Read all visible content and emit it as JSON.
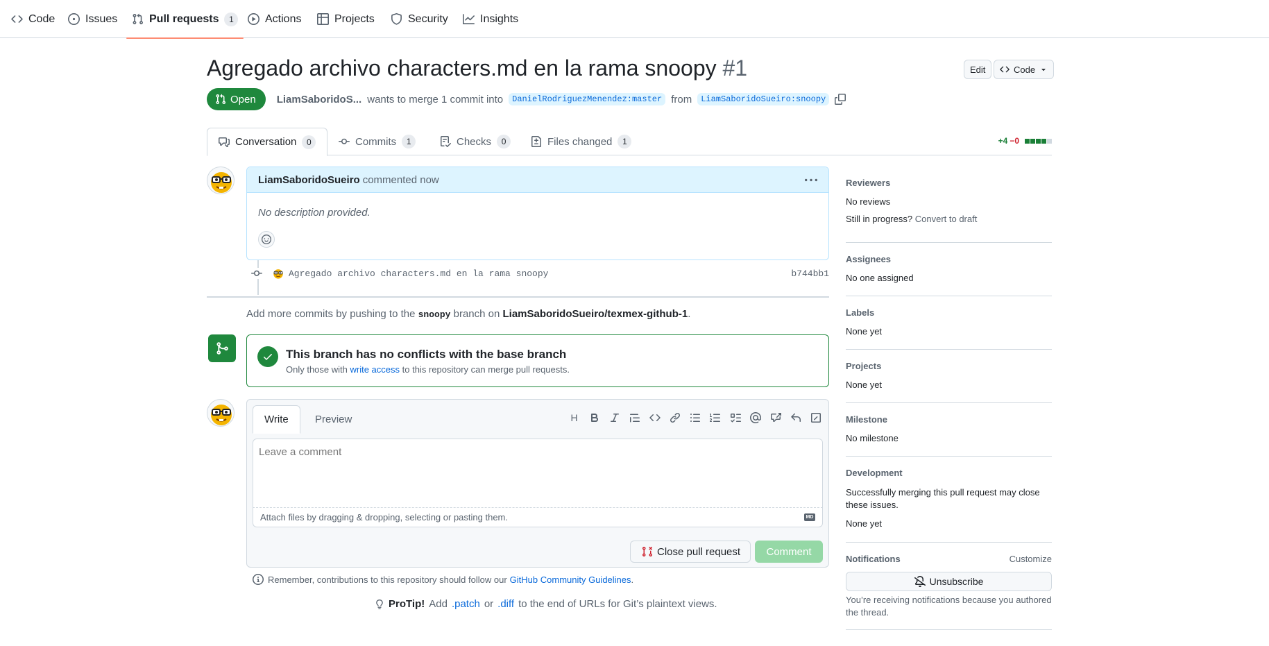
{
  "nav": {
    "code": "Code",
    "issues": "Issues",
    "pull_requests": "Pull requests",
    "pull_requests_count": "1",
    "actions": "Actions",
    "projects": "Projects",
    "security": "Security",
    "insights": "Insights"
  },
  "header": {
    "title": "Agregado archivo characters.md en la rama snoopy",
    "number": "#1",
    "edit_label": "Edit",
    "code_label": "Code",
    "state": "Open",
    "author": "LiamSaboridoS...",
    "merge_text": "wants to merge 1 commit into",
    "base_branch": "DanielRodriguezMenendez:master",
    "from_text": "from",
    "head_branch": "LiamSaboridoSueiro:snoopy"
  },
  "tabs": [
    {
      "label": "Conversation",
      "count": "0"
    },
    {
      "label": "Commits",
      "count": "1"
    },
    {
      "label": "Checks",
      "count": "0"
    },
    {
      "label": "Files changed",
      "count": "1"
    }
  ],
  "diffstat": {
    "additions": "+4",
    "deletions": "−0",
    "colors": [
      "#1a7f37",
      "#1a7f37",
      "#1a7f37",
      "#1a7f37",
      "#d1d9e0"
    ]
  },
  "comment": {
    "author": "LiamSaboridoSueiro",
    "time": "commented now",
    "body": "No description provided."
  },
  "commit": {
    "message": "Agregado archivo characters.md en la rama snoopy",
    "sha": "b744bb1"
  },
  "hint": {
    "prefix": "Add more commits by pushing to the",
    "branch": "snoopy",
    "middle": "branch on",
    "repo": "LiamSaboridoSueiro/texmex-github-1",
    "suffix": "."
  },
  "merge": {
    "title": "This branch has no conflicts with the base branch",
    "sub_prefix": "Only those with",
    "sub_link": "write access",
    "sub_suffix": "to this repository can merge pull requests."
  },
  "editor": {
    "write_tab": "Write",
    "preview_tab": "Preview",
    "placeholder": "Leave a comment",
    "attach": "Attach files by dragging & dropping, selecting or pasting them.",
    "close_label": "Close pull request",
    "comment_label": "Comment",
    "heading_glyph": "H"
  },
  "footer": {
    "guidelines_prefix": "Remember, contributions to this repository should follow our",
    "guidelines_link": "GitHub Community Guidelines",
    "guidelines_suffix": ".",
    "protip_label": "ProTip!",
    "protip_add": "Add",
    "protip_patch": ".patch",
    "protip_or": "or",
    "protip_diff": ".diff",
    "protip_suffix": "to the end of URLs for Git’s plaintext views."
  },
  "sidebar": {
    "reviewers_h": "Reviewers",
    "reviewers_v": "No reviews",
    "in_progress": "Still in progress?",
    "convert": "Convert to draft",
    "assignees_h": "Assignees",
    "assignees_v": "No one assigned",
    "labels_h": "Labels",
    "labels_v": "None yet",
    "projects_h": "Projects",
    "projects_v": "None yet",
    "milestone_h": "Milestone",
    "milestone_v": "No milestone",
    "development_h": "Development",
    "development_desc": "Successfully merging this pull request may close these issues.",
    "development_v": "None yet",
    "notifications_h": "Notifications",
    "customize": "Customize",
    "unsubscribe": "Unsubscribe",
    "notif_desc": "You’re receiving notifications because you authored the thread."
  },
  "colors": {
    "accent": "#0969da",
    "success": "#1f883d",
    "danger": "#cf222e",
    "nav_underline": "#fd8c73"
  }
}
